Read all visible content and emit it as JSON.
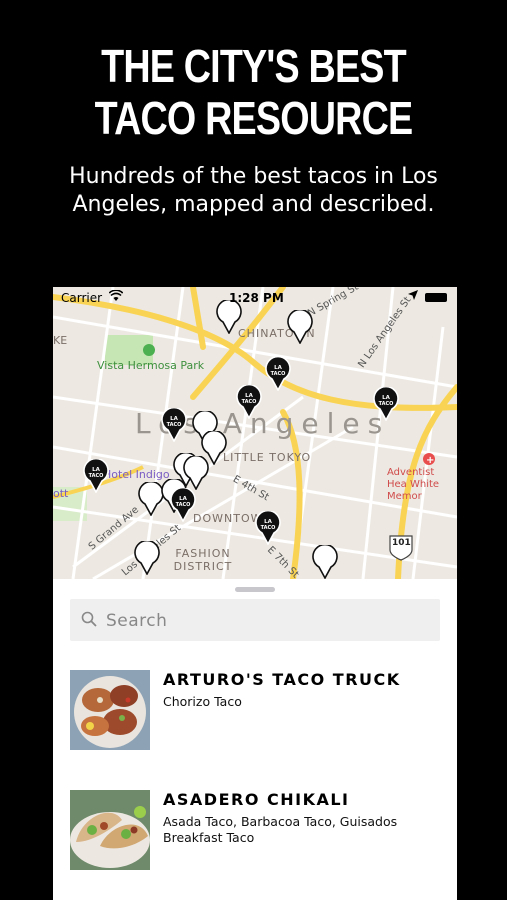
{
  "promo": {
    "headline_line1": "THE CITY'S BEST",
    "headline_line2": "TACO RESOURCE",
    "subtitle": "Hundreds of the best tacos in Los Angeles, mapped and described."
  },
  "status_bar": {
    "carrier": "Carrier",
    "time": "1:28 PM"
  },
  "map": {
    "city_label": "Los Angeles",
    "labels": {
      "chinatown": "CHINATOWN",
      "vista_hermosa": "Vista Hermosa Park",
      "little_tokyo": "LITTLE TOKYO",
      "hotel_indigo": "Hotel Indigo",
      "downtown": "DOWNTOWN",
      "fashion_district": "FASHION DISTRICT",
      "adventist": "Adventist Hea White Memor",
      "e4th": "E 4th St",
      "grand": "S Grand Ave",
      "los_angeles_st": "Los Angeles St",
      "spring": "N Spring St",
      "los_angeles_st2": "N Los Angeles St",
      "e7th": "E 7th St",
      "highway": "101",
      "ke": "KE",
      "ott": "ott"
    },
    "pin_logo_text": "LA TACO"
  },
  "search": {
    "placeholder": "Search"
  },
  "results": [
    {
      "name": "ARTURO'S TACO TRUCK",
      "description": "Chorizo Taco"
    },
    {
      "name": "ASADERO CHIKALI",
      "description": "Asada Taco, Barbacoa Taco, Guisados Breakfast Taco"
    }
  ],
  "colors": {
    "background": "#000000",
    "map_land": "#ede9e2",
    "major_road": "#f9d454",
    "park": "#c6e6b3",
    "pin_black": "#111111",
    "search_bg": "#efefef"
  }
}
